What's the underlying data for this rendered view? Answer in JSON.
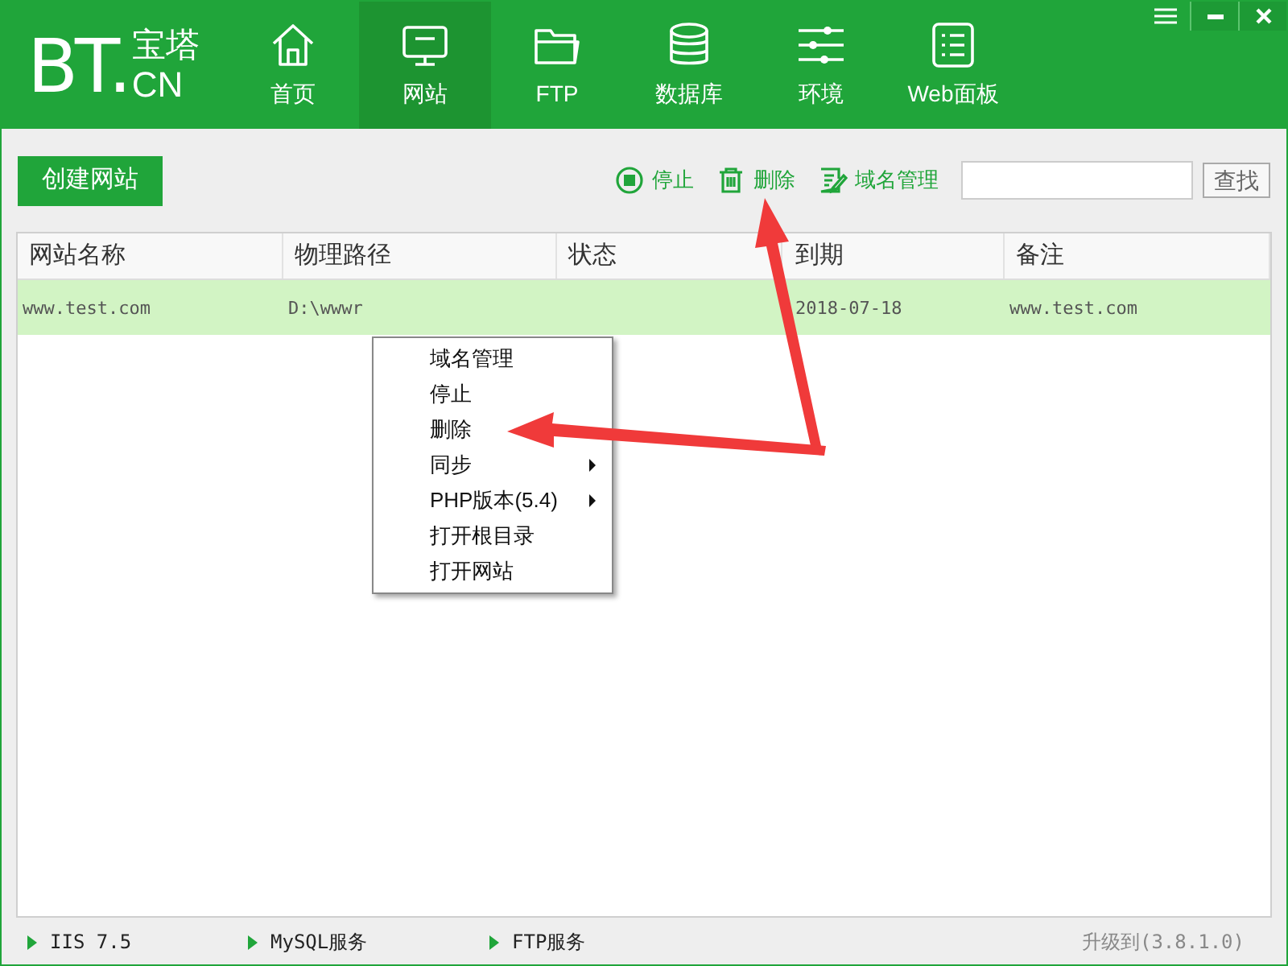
{
  "logo": {
    "main": "BT.",
    "top": "宝塔",
    "bottom": "CN"
  },
  "nav": [
    {
      "label": "首页",
      "kind": "home",
      "selected": false
    },
    {
      "label": "网站",
      "kind": "monitor",
      "selected": true
    },
    {
      "label": "FTP",
      "kind": "folder",
      "selected": false
    },
    {
      "label": "数据库",
      "kind": "database",
      "selected": false
    },
    {
      "label": "环境",
      "kind": "sliders",
      "selected": false
    },
    {
      "label": "Web面板",
      "kind": "list",
      "selected": false
    }
  ],
  "create_button": "创建网站",
  "toolbar": [
    {
      "label": "停止",
      "kind": "stop"
    },
    {
      "label": "删除",
      "kind": "trash"
    },
    {
      "label": "域名管理",
      "kind": "edit"
    }
  ],
  "search": {
    "button": "查找"
  },
  "table": {
    "columns": [
      "网站名称",
      "物理路径",
      "状态",
      "到期",
      "备注"
    ],
    "rows": [
      {
        "selected": true,
        "name": "www.test.com",
        "path": "D:\\wwwr",
        "expires": "2018-07-18",
        "note": "www.test.com"
      }
    ]
  },
  "context_menu": [
    {
      "label": "域名管理",
      "submenu": false
    },
    {
      "label": "停止",
      "submenu": false
    },
    {
      "label": "删除",
      "submenu": false
    },
    {
      "label": "同步",
      "submenu": true
    },
    {
      "label": "PHP版本(5.4)",
      "submenu": true
    },
    {
      "label": "打开根目录",
      "submenu": false
    },
    {
      "label": "打开网站",
      "submenu": false
    }
  ],
  "status_bar": {
    "services": [
      "IIS 7.5",
      "MySQL服务",
      "FTP服务"
    ],
    "update": "升级到(3.8.1.0)"
  }
}
